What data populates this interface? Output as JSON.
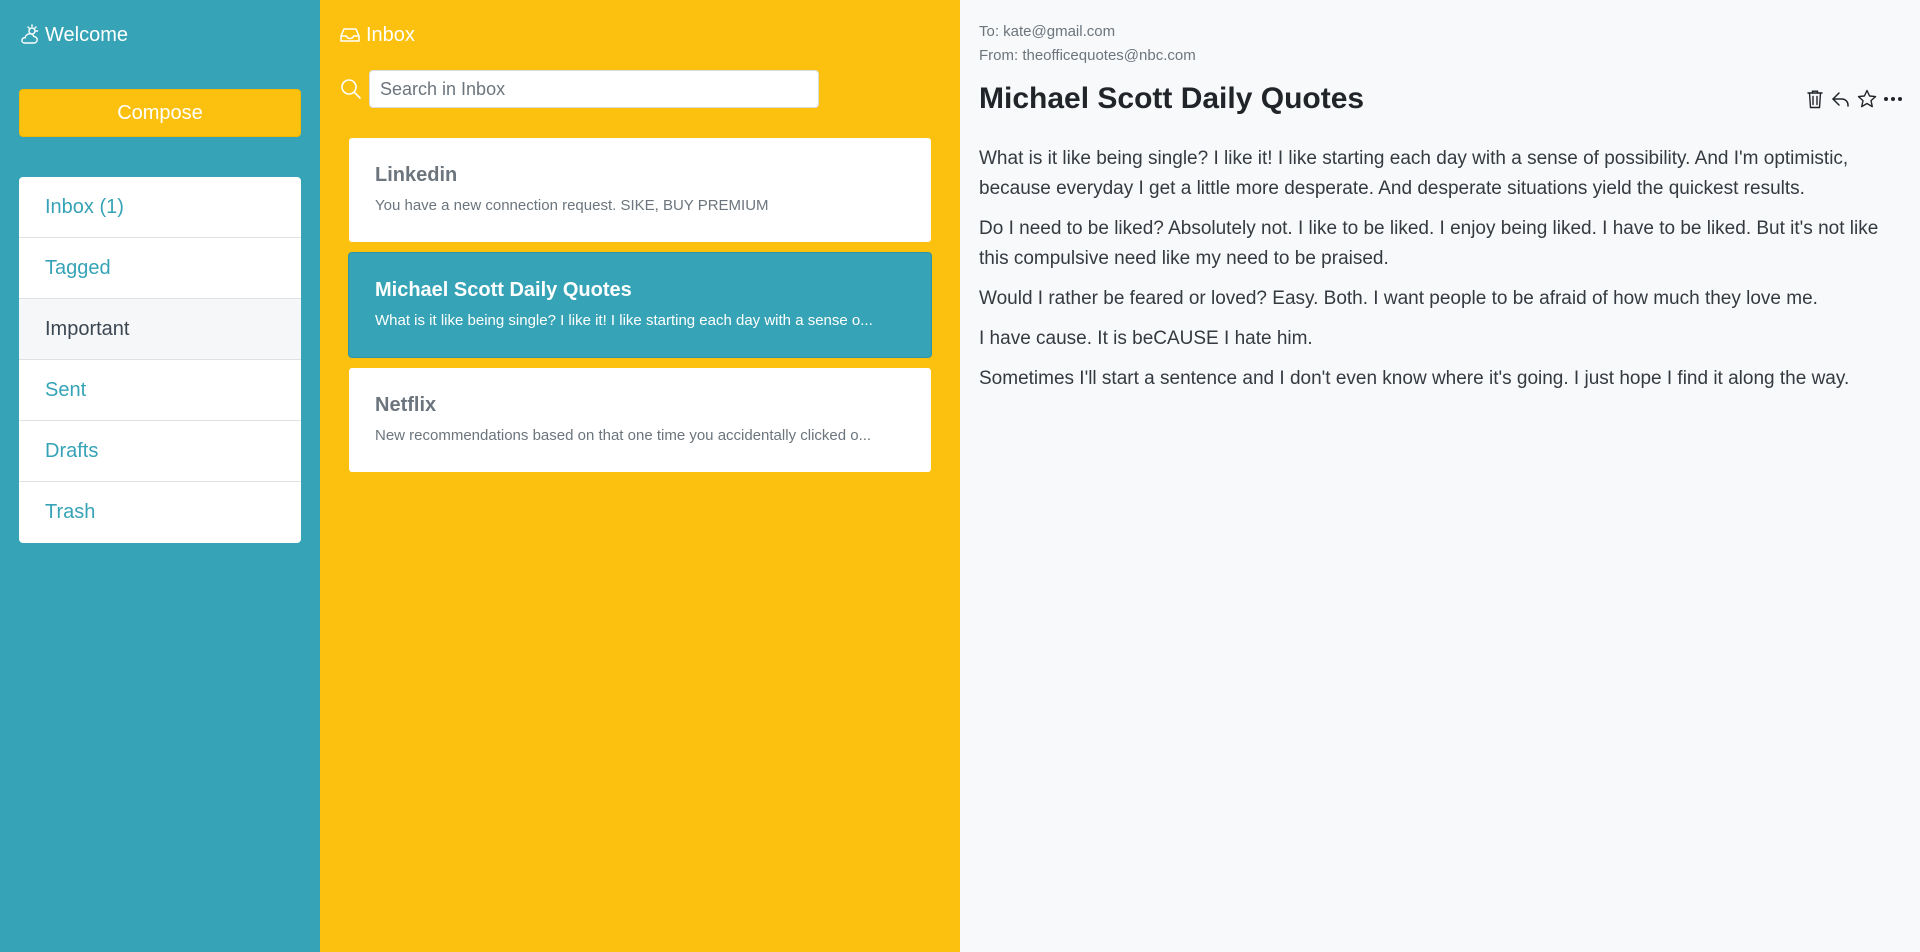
{
  "sidebar": {
    "title": "Welcome",
    "compose_label": "Compose",
    "items": [
      {
        "label": "Inbox (1)"
      },
      {
        "label": "Tagged"
      },
      {
        "label": "Important"
      },
      {
        "label": "Sent"
      },
      {
        "label": "Drafts"
      },
      {
        "label": "Trash"
      }
    ]
  },
  "inbox": {
    "title": "Inbox",
    "search_placeholder": "Search in Inbox",
    "emails": [
      {
        "sender": "Linkedin",
        "preview": "You have a new connection request. SIKE, BUY PREMIUM"
      },
      {
        "sender": "Michael Scott Daily Quotes",
        "preview": "What is it like being single? I like it! I like starting each day with a sense o..."
      },
      {
        "sender": "Netflix",
        "preview": "New recommendations based on that one time you accidentally clicked o..."
      }
    ]
  },
  "reader": {
    "to": "To: kate@gmail.com",
    "from": "From: theofficequotes@nbc.com",
    "subject": "Michael Scott Daily Quotes",
    "paragraphs": [
      "What is it like being single? I like it! I like starting each day with a sense of possibility. And I'm optimistic, because everyday I get a little more desperate. And desperate situations yield the quickest results.",
      "Do I need to be liked? Absolutely not. I like to be liked. I enjoy being liked. I have to be liked. But it's not like this compulsive need like my need to be praised.",
      "Would I rather be feared or loved? Easy. Both. I want people to be afraid of how much they love me.",
      "I have cause. It is beCAUSE I hate him.",
      "Sometimes I'll start a sentence and I don't even know where it's going. I just hope I find it along the way."
    ]
  },
  "icons": {
    "brand": "cloud-sun-icon",
    "inbox": "inbox-tray-icon",
    "search": "search-icon",
    "delete": "trash-icon",
    "reply": "reply-icon",
    "star": "star-icon",
    "more": "more-icon"
  },
  "colors": {
    "sidebar": "#36a3b6",
    "inbox_pane": "#fbc10e",
    "reader_bg": "#f8f9fa"
  }
}
